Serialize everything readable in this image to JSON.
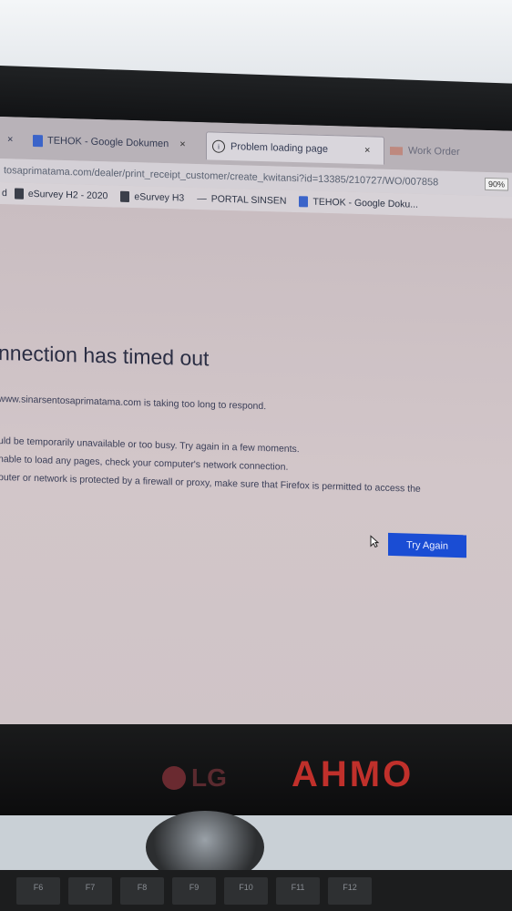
{
  "tabs": [
    {
      "label": "TEHOK - Google Dokumen",
      "close": "×"
    },
    {
      "label": "Problem loading page",
      "close": "×"
    },
    {
      "label": "Work Order"
    }
  ],
  "address_bar": {
    "url": "tosaprimatama.com/dealer/print_receipt_customer/create_kwitansi?id=13385/210727/WO/007858",
    "zoom": "90%"
  },
  "bookmarks": [
    {
      "label": "eSurvey H2 - 2020"
    },
    {
      "label": "eSurvey H3"
    },
    {
      "label": "PORTAL SINSEN"
    },
    {
      "label": "TEHOK - Google Doku..."
    }
  ],
  "error": {
    "title": "nnection has timed out",
    "description": "www.sinarsentosaprimatama.com is taking too long to respond.",
    "items": [
      "uld be temporarily unavailable or too busy. Try again in a few moments.",
      "nable to load any pages, check your computer's network connection.",
      "puter or network is protected by a firewall or proxy, make sure that Firefox is permitted to access the"
    ],
    "button": "Try Again"
  },
  "monitor": {
    "brand": "LG",
    "sticker": "AHMO"
  },
  "keys": [
    "F6",
    "F7",
    "F8",
    "F9",
    "F10",
    "F11",
    "F12"
  ],
  "colors": {
    "accent": "#1a4dd4",
    "bezel": "#111214"
  }
}
